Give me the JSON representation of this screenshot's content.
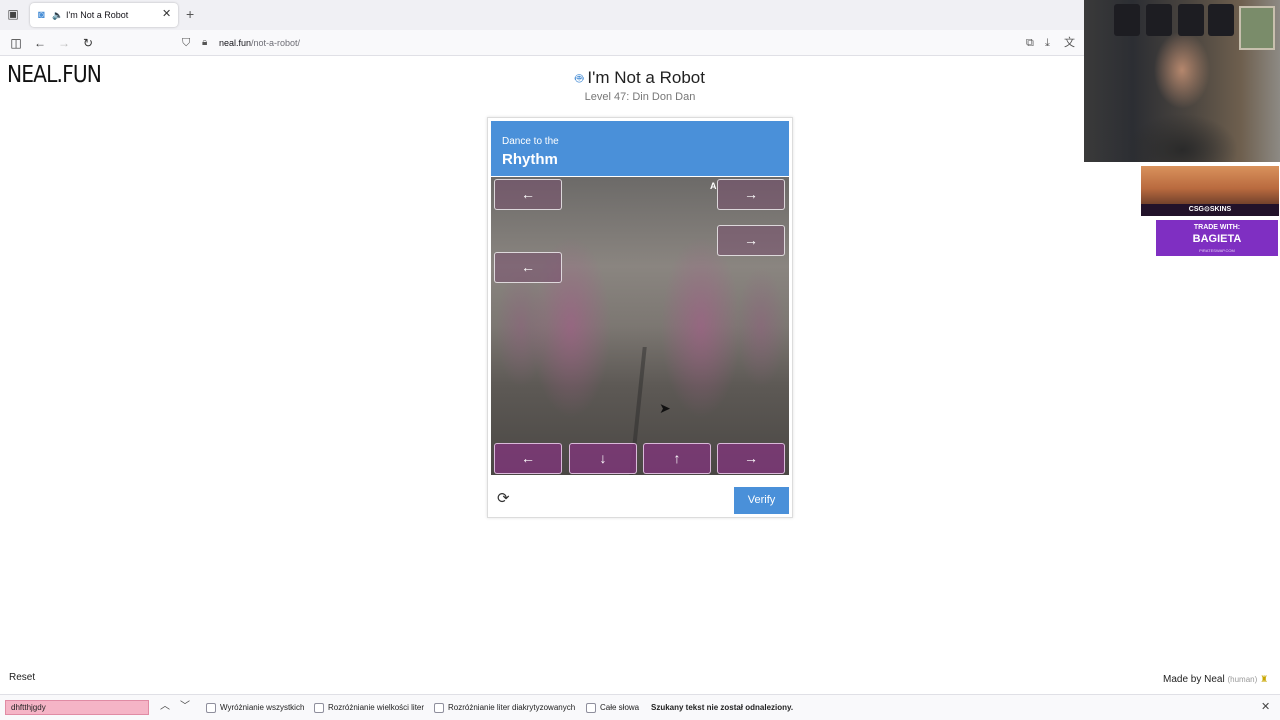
{
  "browser": {
    "tab_title": "I'm Not a Robot",
    "url_host": "neal.fun",
    "url_path": "/not-a-robot/",
    "icons": [
      "tabs-icon",
      "speaker-icon",
      "close-icon",
      "new-tab-icon",
      "sidebar-icon",
      "back-icon",
      "forward-icon",
      "reload-icon",
      "shield-icon",
      "lock-icon",
      "picture-in-picture-icon",
      "downloads-icon",
      "translate-icon"
    ]
  },
  "page": {
    "logo": "NEAL.FUN",
    "title": "I'm Not a Robot",
    "level": "Level 47: Din Don Dan",
    "reset": "Reset",
    "made_by": "Made by Neal",
    "human": "(human)"
  },
  "captcha": {
    "subtitle": "Dance to the",
    "title": "Rhythm",
    "partial_text": "A",
    "accent_color": "#4a90d9",
    "falling_arrows": [
      "←",
      "→",
      "→",
      "←"
    ],
    "targets": [
      "←",
      "↓",
      "↑",
      "→"
    ],
    "verify": "Verify"
  },
  "findbar": {
    "query": "dhftthjgdy",
    "options": [
      "Wyróżnianie wszystkich",
      "Rozróżnianie wielkości liter",
      "Rozróżnianie liter diakrytyzowanych",
      "Całe słowa"
    ],
    "status": "Szukany tekst nie został odnaleziony."
  },
  "overlay": {
    "csgo_tag": "CSG⊙SKINS",
    "trade_line1": "TRADE WITH:",
    "trade_line2": "BAGIETA",
    "trade_line3": "PIRATESWAP.COM"
  }
}
